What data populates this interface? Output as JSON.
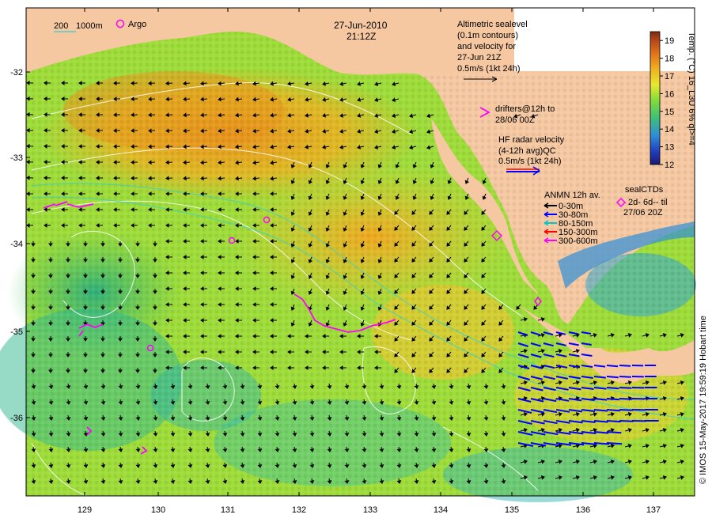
{
  "header": {
    "date": "27-Jun-2010",
    "time": "21:12Z",
    "isobath_labels": [
      "200",
      "1000m"
    ],
    "argo_label": "Argo"
  },
  "altimetry": {
    "lines": [
      "Altimetric sealevel",
      "(0.1m contours)",
      "and velocity for",
      "27-Jun 21Z",
      "0.5m/s (1kt 24h)"
    ]
  },
  "drifters": {
    "lines": [
      "drifters@12h to",
      "28/06 00Z"
    ]
  },
  "hf_radar": {
    "lines": [
      "HF radar velocity",
      "(4-12h avg)QC",
      "0.5m/s (1kt 24h)"
    ]
  },
  "anmn": {
    "title": "ANMN 12h av.",
    "items": [
      {
        "label": "0-30m",
        "color": "#000000"
      },
      {
        "label": "30-80m",
        "color": "#0000ff"
      },
      {
        "label": "80-150m",
        "color": "#00c8c8"
      },
      {
        "label": "150-300m",
        "color": "#ff0000"
      },
      {
        "label": "300-600m",
        "color": "#ff00ff"
      }
    ]
  },
  "sealctds": {
    "lines": [
      "sealCTDs",
      "2d- 6d-- til",
      "27/06 20Z"
    ]
  },
  "colorbar": {
    "label": "Temp. (°C) 16_L3U 6% ql>=4",
    "ticks": [
      "19",
      "18",
      "17",
      "16",
      "15",
      "14",
      "13",
      "12"
    ],
    "range": [
      12,
      19.5
    ],
    "colors": [
      "#1a1a6e",
      "#1f3fc0",
      "#2f8fd8",
      "#3cc07a",
      "#7fdc3a",
      "#e8e830",
      "#f0b020",
      "#e07018",
      "#b84818",
      "#7a2a10"
    ]
  },
  "axes": {
    "x_ticks": [
      "129",
      "130",
      "131",
      "132",
      "133",
      "134",
      "135",
      "136",
      "137"
    ],
    "y_ticks": [
      "-32",
      "-33",
      "-34",
      "-35",
      "-36"
    ]
  },
  "footer": {
    "credit": "© IMOS 15-May-2017 19:59:19 Hobart time"
  }
}
